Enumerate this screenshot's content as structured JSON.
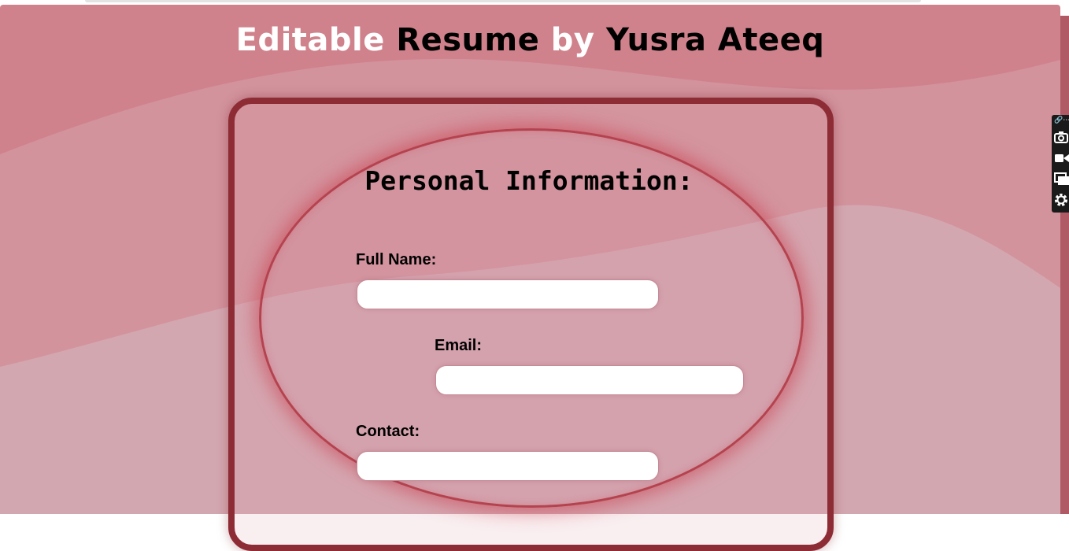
{
  "title": {
    "word1": "Editable",
    "word2": "Resume",
    "word3": "by",
    "word4": "Yusra Ateeq"
  },
  "section": {
    "heading": "Personal Information:"
  },
  "fields": {
    "full_name": {
      "label": "Full Name:",
      "value": ""
    },
    "email": {
      "label": "Email:",
      "value": ""
    },
    "contact": {
      "label": "Contact:",
      "value": ""
    }
  },
  "extension_toolbar": {
    "items": [
      "link-icon",
      "camera-icon",
      "video-icon",
      "windows-icon",
      "gear-icon"
    ]
  },
  "colors": {
    "background": "#d0828c",
    "card_border": "#8e2c35",
    "oval_border": "#b4434f"
  }
}
